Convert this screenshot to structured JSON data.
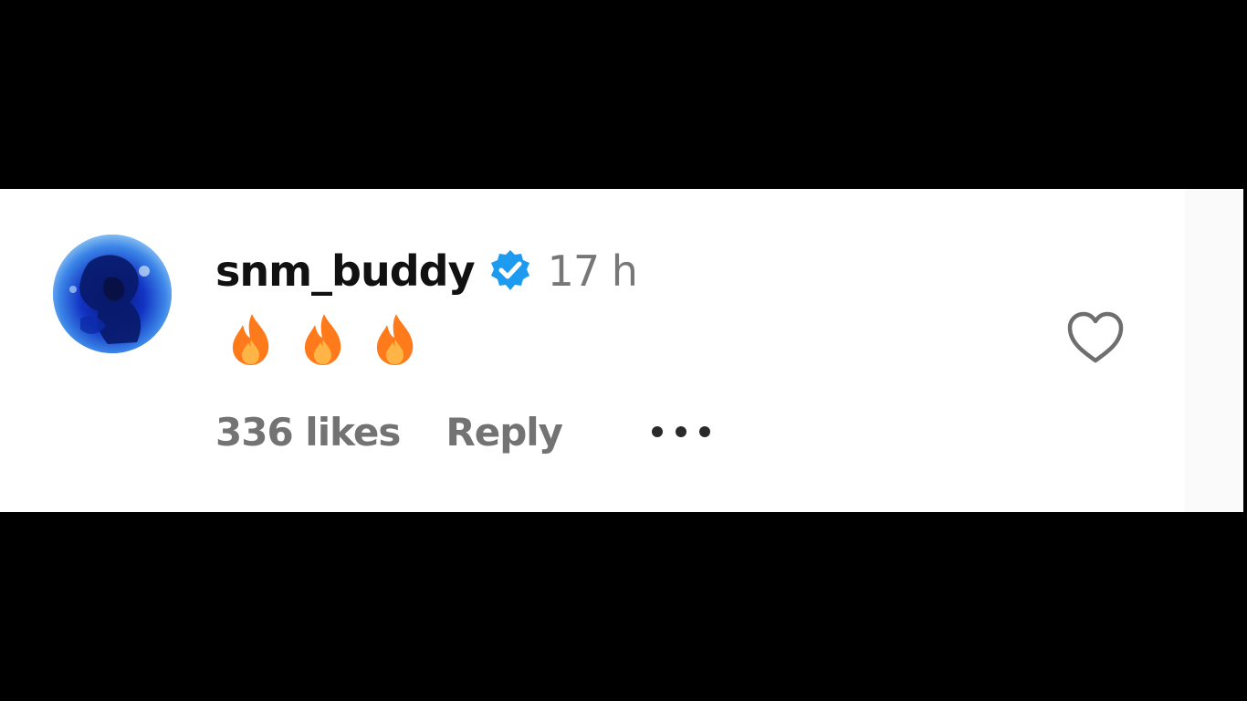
{
  "comment": {
    "username": "snm_buddy",
    "verified_icon": "verified-badge-icon",
    "time": "17 h",
    "body_emojis": [
      "fire-emoji",
      "fire-emoji",
      "fire-emoji"
    ],
    "likes": "336 likes",
    "reply_label": "Reply",
    "more_icon": "more-options-icon",
    "like_icon": "heart-outline-icon"
  },
  "colors": {
    "background_frame": "#000000",
    "panel": "#ffffff",
    "username": "#111111",
    "meta_text": "#737373",
    "verified_blue": "#1d9bf0",
    "fire_orange": "#ff7a1a"
  }
}
